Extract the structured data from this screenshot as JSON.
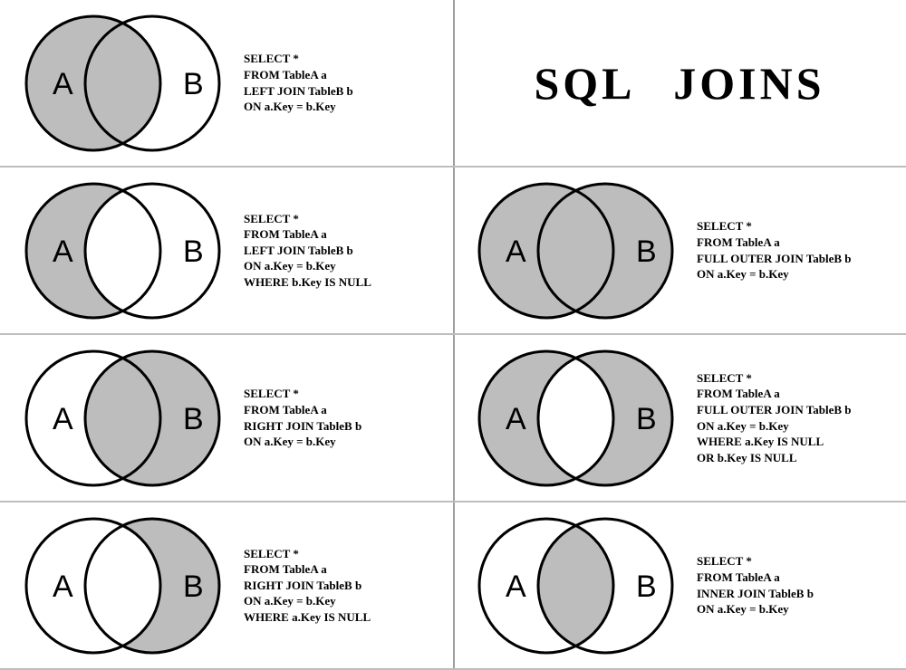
{
  "title": "SQL JOINS",
  "labels": {
    "a": "A",
    "b": "B"
  },
  "fill": "#bdbdbd",
  "cells": [
    {
      "sql": "SELECT *\nFROM TableA a\nLEFT JOIN TableB b\nON a.Key = b.Key",
      "shadeA": true,
      "shadeB": false,
      "shadeOverlap": true
    },
    {
      "sql": "SELECT *\nFROM TableA a\nLEFT JOIN TableB b\nON a.Key = b.Key\nWHERE b.Key IS NULL",
      "shadeA": true,
      "shadeB": false,
      "shadeOverlap": false
    },
    {
      "sql": "SELECT *\nFROM TableA a\nFULL OUTER JOIN TableB b\nON a.Key = b.Key",
      "shadeA": true,
      "shadeB": true,
      "shadeOverlap": true
    },
    {
      "sql": "SELECT *\nFROM TableA a\nRIGHT JOIN TableB b\nON a.Key = b.Key",
      "shadeA": false,
      "shadeB": true,
      "shadeOverlap": true
    },
    {
      "sql": "SELECT *\nFROM TableA a\nFULL OUTER JOIN TableB b\nON a.Key = b.Key\nWHERE a.Key IS NULL\nOR b.Key IS NULL",
      "shadeA": true,
      "shadeB": true,
      "shadeOverlap": false
    },
    {
      "sql": "SELECT *\nFROM TableA a\nRIGHT JOIN TableB b\nON a.Key = b.Key\nWHERE a.Key IS NULL",
      "shadeA": false,
      "shadeB": true,
      "shadeOverlap": false
    },
    {
      "sql": "SELECT *\nFROM TableA a\nINNER JOIN TableB b\nON a.Key = b.Key",
      "shadeA": false,
      "shadeB": false,
      "shadeOverlap": true
    }
  ]
}
